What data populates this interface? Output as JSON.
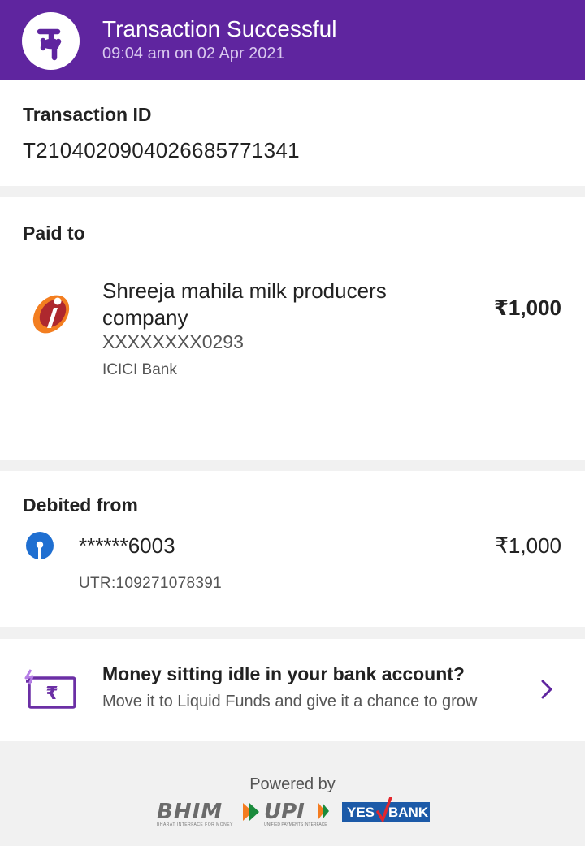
{
  "header": {
    "title": "Transaction Successful",
    "timestamp": "09:04 am on 02 Apr 2021",
    "logo_icon": "phonepe-logo-icon",
    "bg_color": "#5f259f"
  },
  "transaction": {
    "label": "Transaction ID",
    "id": "T2104020904026685771341"
  },
  "paid_to": {
    "label": "Paid to",
    "payee_name": "Shreeja mahila milk producers company",
    "account": "XXXXXXXX0293",
    "bank": "ICICI Bank",
    "bank_icon": "icici-bank-logo-icon",
    "amount": "₹1,000"
  },
  "debited_from": {
    "label": "Debited from",
    "account": "******6003",
    "bank_icon": "sbi-bank-logo-icon",
    "amount": "₹1,000",
    "utr": "UTR:109271078391"
  },
  "promo": {
    "title": "Money sitting idle in your bank account?",
    "subtitle": "Move it to Liquid Funds and give it a chance to grow",
    "icon": "rupee-card-icon",
    "action_icon": "chevron-right-icon"
  },
  "footer": {
    "powered_by": "Powered by",
    "bhim": "BHIM",
    "bhim_tagline": "BHARAT INTERFACE FOR MONEY",
    "upi": "UPI",
    "upi_tagline": "UNIFIED PAYMENTS INTERFACE",
    "bank_yes": "YES",
    "bank_name": "BANK"
  }
}
